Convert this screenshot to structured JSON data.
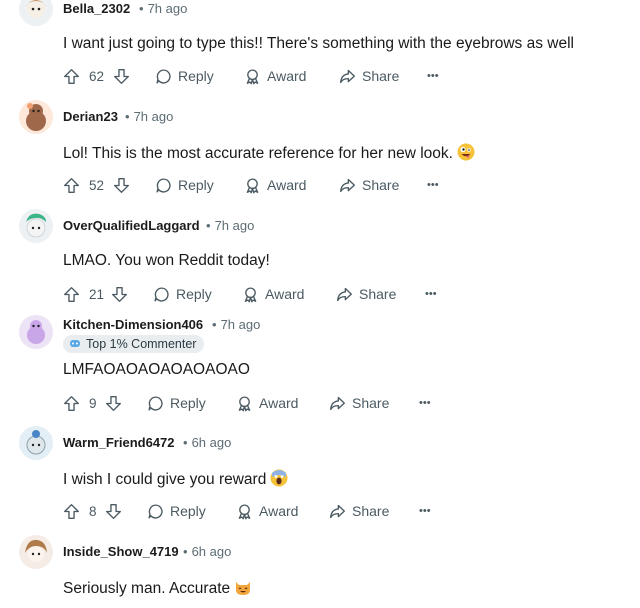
{
  "comments": [
    {
      "user": "Bella_2302",
      "time": "7h ago",
      "text": "I want just going to type this!! There's something with the eyebrows as well",
      "emoji": "",
      "votes": "62",
      "flair": ""
    },
    {
      "user": "Derian23",
      "time": "7h ago",
      "text": "Lol! This is the most accurate reference for her new look.",
      "emoji": "🤪",
      "votes": "52",
      "flair": ""
    },
    {
      "user": "OverQualifiedLaggard",
      "time": "7h ago",
      "text": "LMAO. You won Reddit today!",
      "emoji": "",
      "votes": "21",
      "flair": ""
    },
    {
      "user": "Kitchen-Dimension406",
      "time": "7h ago",
      "text": "LMFAOAOAOAOAOAOAO",
      "emoji": "",
      "votes": "9",
      "flair": "Top 1% Commenter"
    },
    {
      "user": "Warm_Friend6472",
      "time": "6h ago",
      "text": "I wish I could give you reward",
      "emoji": "😱",
      "votes": "8",
      "flair": ""
    },
    {
      "user": "Inside_Show_4719",
      "time": "6h ago",
      "text": "Seriously man. Accurate",
      "emoji": "😹",
      "votes": "",
      "flair": ""
    }
  ],
  "actions": {
    "reply": "Reply",
    "award": "Award",
    "share": "Share",
    "more": "•••"
  },
  "colors": {
    "meta": "#5c6c74",
    "text": "#1a1a1b",
    "flair_bg": "#eaedef"
  }
}
